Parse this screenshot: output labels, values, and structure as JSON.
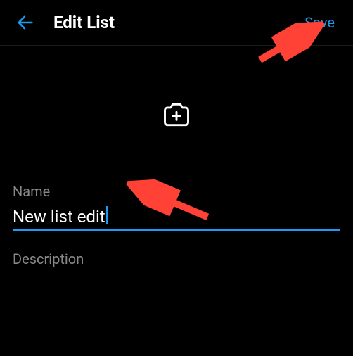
{
  "header": {
    "title": "Edit List",
    "save_label": "Save"
  },
  "form": {
    "name_label": "Name",
    "name_value": "New list edit",
    "description_label": "Description"
  },
  "icons": {
    "back": "back-arrow-icon",
    "camera": "camera-add-icon"
  },
  "colors": {
    "accent": "#1d9bf0",
    "annotation": "#ff4136"
  }
}
